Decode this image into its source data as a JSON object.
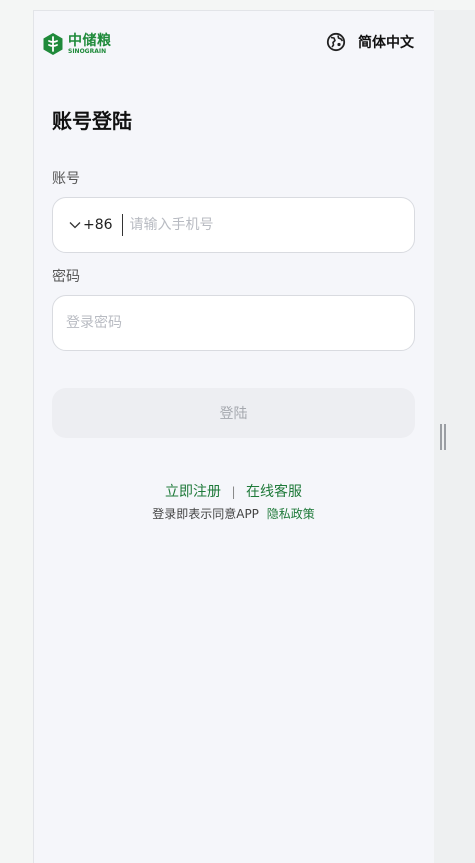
{
  "brand": {
    "name_cn": "中储粮",
    "name_en": "SINOGRAIN",
    "logo_color": "#1f8a3a"
  },
  "header": {
    "language_icon": "globe-icon",
    "language_label": "简体中文"
  },
  "form": {
    "title": "账号登陆",
    "account_label": "账号",
    "country_code": "+86",
    "country_chevron_icon": "chevron-down-icon",
    "phone_placeholder": "请输入手机号",
    "password_label": "密码",
    "password_placeholder": "登录密码",
    "login_button": "登陆"
  },
  "footer": {
    "register_link": "立即注册",
    "separator": "|",
    "service_link": "在线客服",
    "agreement_text": "登录即表示同意APP",
    "privacy_link": "隐私政策"
  },
  "colors": {
    "accent": "#1f7a3a",
    "page_bg": "#f5f6fa",
    "button_disabled_bg": "#edeef2"
  }
}
